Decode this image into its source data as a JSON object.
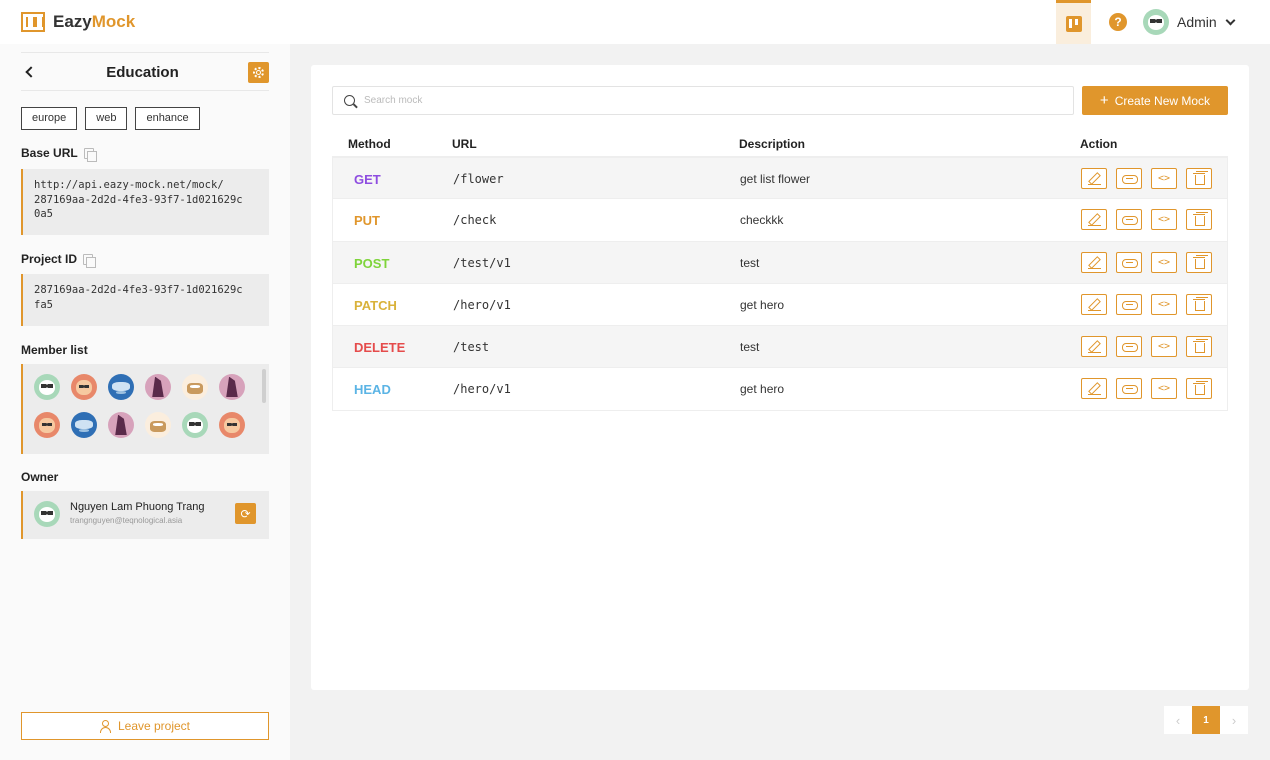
{
  "header": {
    "brand_part1": "Eazy",
    "brand_part2": "Mock",
    "help_glyph": "?",
    "user_name": "Admin",
    "icons": {
      "board": "kanban-board-icon",
      "help": "help-icon",
      "menu": "chevron-down-icon"
    }
  },
  "colors": {
    "accent": "#e0962c",
    "GET": "#8e4de0",
    "PUT": "#e0962c",
    "POST": "#7ed43a",
    "PATCH": "#d9b23a",
    "DELETE": "#e54b4b",
    "HEAD": "#5bb4e5"
  },
  "sidebar": {
    "project_title": "Education",
    "tags": [
      "europe",
      "web",
      "enhance"
    ],
    "base_url_label": "Base URL",
    "base_url_lines": [
      "http://api.eazy-mock.net/mock/",
      "287169aa-2d2d-4fe3-93f7-1d021629c",
      "0a5"
    ],
    "project_id_label": "Project ID",
    "project_id_lines": [
      "287169aa-2d2d-4fe3-93f7-1d021629c",
      "fa5"
    ],
    "member_list_label": "Member list",
    "members": [
      "panda",
      "tiger",
      "monkey",
      "horse",
      "sloth",
      "horse",
      "tiger",
      "monkey",
      "horse",
      "sloth",
      "panda",
      "tiger"
    ],
    "owner_label": "Owner",
    "owner_name": "Nguyen Lam Phuong Trang",
    "owner_email": "trangnguyen@teqnological.asia",
    "leave_label": "Leave project"
  },
  "main": {
    "search_placeholder": "Search mock",
    "create_label": "Create New Mock",
    "columns": {
      "method": "Method",
      "url": "URL",
      "description": "Description",
      "action": "Action"
    },
    "rows": [
      {
        "method": "GET",
        "url": "/flower",
        "description": "get list flower"
      },
      {
        "method": "PUT",
        "url": "/check",
        "description": "checkkk"
      },
      {
        "method": "POST",
        "url": "/test/v1",
        "description": "test"
      },
      {
        "method": "PATCH",
        "url": "/hero/v1",
        "description": "get hero"
      },
      {
        "method": "DELETE",
        "url": "/test",
        "description": "test"
      },
      {
        "method": "HEAD",
        "url": "/hero/v1",
        "description": "get hero"
      }
    ],
    "row_actions": [
      "edit-icon",
      "link-icon",
      "code-icon",
      "trash-icon"
    ]
  },
  "pagination": {
    "prev": "‹",
    "current": "1",
    "next": "›"
  }
}
